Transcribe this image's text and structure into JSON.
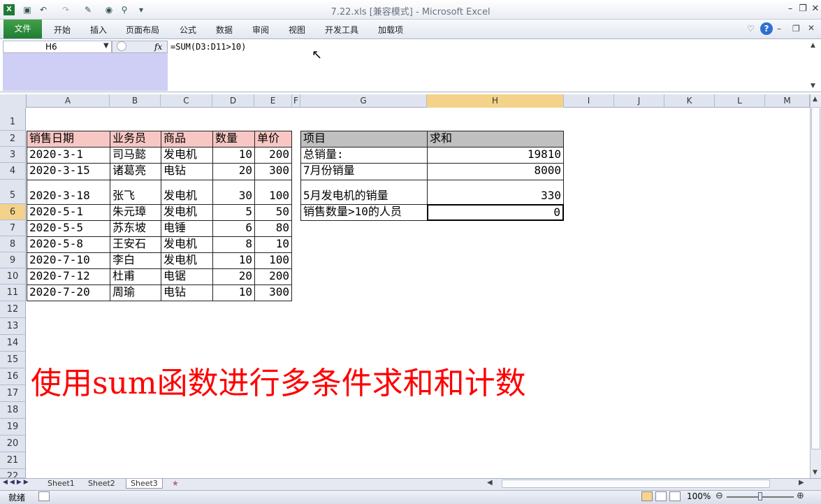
{
  "window": {
    "title": "7.22.xls  [兼容模式]  -  Microsoft Excel"
  },
  "ribbon": {
    "file_tab": "文件",
    "tabs": [
      "开始",
      "插入",
      "页面布局",
      "公式",
      "数据",
      "审阅",
      "视图",
      "开发工具",
      "加载项"
    ]
  },
  "formula_bar": {
    "name_box": "H6",
    "fx_label": "fx",
    "formula": "=SUM(D3:D11>10)"
  },
  "columns": [
    "A",
    "B",
    "C",
    "D",
    "E",
    "F",
    "G",
    "H",
    "I",
    "J",
    "K",
    "L",
    "M"
  ],
  "rows": [
    "1",
    "2",
    "3",
    "4",
    "5",
    "6",
    "7",
    "8",
    "9",
    "10",
    "11",
    "12",
    "13",
    "14",
    "15",
    "16",
    "17",
    "18",
    "19",
    "20",
    "21",
    "22"
  ],
  "sales_table": {
    "headers": [
      "销售日期",
      "业务员",
      "商品",
      "数量",
      "单价"
    ],
    "rows": [
      [
        "2020-3-1",
        "司马懿",
        "发电机",
        "10",
        "200"
      ],
      [
        "2020-3-15",
        "诸葛亮",
        "电钻",
        "20",
        "300"
      ],
      [
        "2020-3-18",
        "张飞",
        "发电机",
        "30",
        "100"
      ],
      [
        "2020-5-1",
        "朱元璋",
        "发电机",
        "5",
        "50"
      ],
      [
        "2020-5-5",
        "苏东坡",
        "电锤",
        "6",
        "80"
      ],
      [
        "2020-5-8",
        "王安石",
        "发电机",
        "8",
        "10"
      ],
      [
        "2020-7-10",
        "李白",
        "发电机",
        "10",
        "100"
      ],
      [
        "2020-7-12",
        "杜甫",
        "电锯",
        "20",
        "200"
      ],
      [
        "2020-7-20",
        "周瑜",
        "电钻",
        "10",
        "300"
      ]
    ]
  },
  "summary_table": {
    "headers": [
      "项目",
      "求和"
    ],
    "rows": [
      [
        "总销量:",
        "19810"
      ],
      [
        "7月份销量",
        "8000"
      ],
      [
        "5月发电机的销量",
        "330"
      ],
      [
        "销售数量>10的人员",
        "0"
      ]
    ]
  },
  "banner_text": "使用sum函数进行多条件求和和计数",
  "sheets": [
    "Sheet1",
    "Sheet2",
    "Sheet3"
  ],
  "status": {
    "ready": "就绪",
    "zoom": "100%"
  },
  "colors": {
    "header_red": "#f8c7c4",
    "header_gray": "#c0c0c0",
    "banner": "#ff0000",
    "file_tab": "#2e8b3c"
  }
}
